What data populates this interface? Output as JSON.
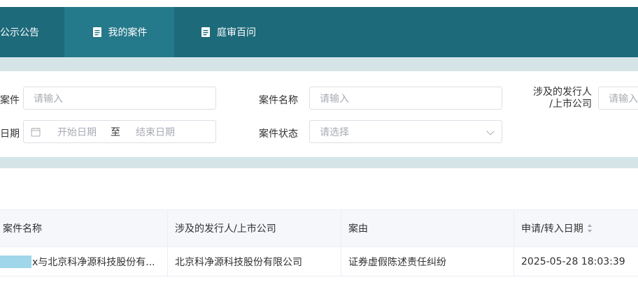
{
  "nav": {
    "items": [
      {
        "label": "公示公告"
      },
      {
        "label": "我的案件",
        "active": true,
        "icon": "document-icon"
      },
      {
        "label": "庭审百问",
        "icon": "document-icon"
      }
    ]
  },
  "filters": {
    "case_no_label": "案件",
    "case_no_placeholder": "请输入",
    "case_name_label": "案件名称",
    "case_name_placeholder": "请输入",
    "issuer_label_line1": "涉及的发行人",
    "issuer_label_line2": "/上市公司",
    "issuer_placeholder": "请输入",
    "date_label": "日期",
    "date_start_placeholder": "开始日期",
    "date_separator": "至",
    "date_end_placeholder": "结束日期",
    "status_label": "案件状态",
    "status_placeholder": "请选择"
  },
  "table": {
    "columns": [
      "案件名称",
      "涉及的发行人/上市公司",
      "案由",
      "申请/转入日期"
    ],
    "rows": [
      [
        "x与北京科净源科技股份有...",
        "北京科净源科技股份有限公司",
        "证券虚假陈述责任纠纷",
        "2025-05-28 18:03:39"
      ]
    ]
  },
  "colors": {
    "nav_bg": "#1d6a7a",
    "nav_active": "#24798a",
    "band": "#d5e5e7"
  }
}
